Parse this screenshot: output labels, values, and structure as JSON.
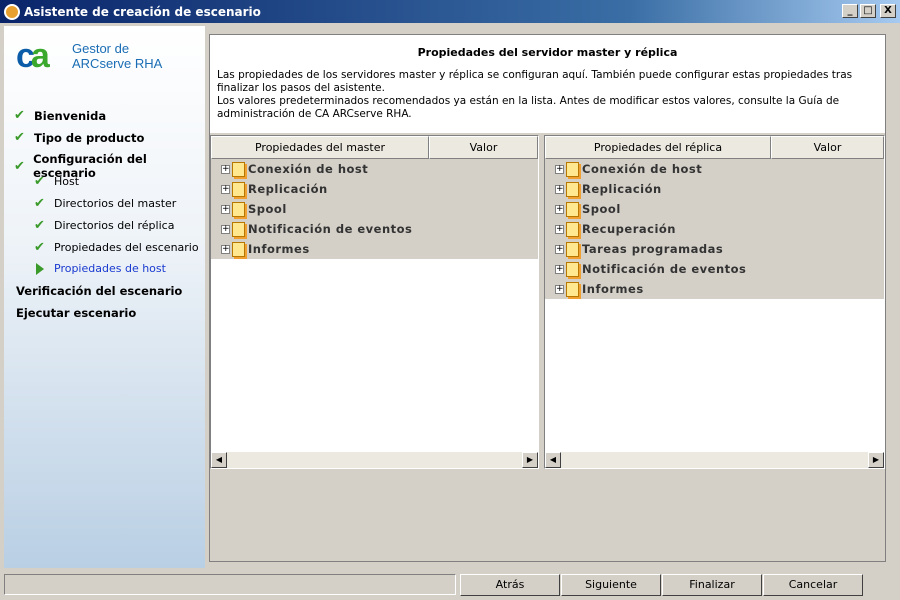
{
  "window": {
    "title": "Asistente de creación de escenario",
    "min": "_",
    "max": "□",
    "close": "X"
  },
  "logo": {
    "mark": "ca",
    "line1": "Gestor de",
    "line2": "ARCserve RHA"
  },
  "steps": [
    {
      "label": "Bienvenida",
      "state": "done"
    },
    {
      "label": "Tipo de producto",
      "state": "done"
    },
    {
      "label": "Configuración del escenario",
      "state": "done"
    },
    {
      "label": "Host",
      "state": "done"
    },
    {
      "label": "Directorios del master",
      "state": "done"
    },
    {
      "label": "Directorios del réplica",
      "state": "done"
    },
    {
      "label": "Propiedades del escenario",
      "state": "done"
    },
    {
      "label": "Propiedades de host",
      "state": "current"
    },
    {
      "label": "Verificación del escenario",
      "state": "pending"
    },
    {
      "label": "Ejecutar escenario",
      "state": "pending"
    }
  ],
  "header": {
    "title": "Propiedades del servidor master y réplica",
    "p1": "Las propiedades de los servidores master y réplica se configuran aquí. También puede configurar estas propiedades tras finalizar los pasos del asistente.",
    "p2": "Los valores predeterminados recomendados ya están en la lista. Antes de modificar estos valores, consulte la Guía de administración de CA ARCserve RHA."
  },
  "master": {
    "col1": "Propiedades del master",
    "col2": "Valor",
    "items": [
      "Conexión de host",
      "Replicación",
      "Spool",
      "Notificación de eventos",
      "Informes"
    ]
  },
  "replica": {
    "col1": "Propiedades del réplica",
    "col2": "Valor",
    "items": [
      "Conexión de host",
      "Replicación",
      "Spool",
      "Recuperación",
      "Tareas programadas",
      "Notificación de eventos",
      "Informes"
    ]
  },
  "buttons": {
    "back": "Atrás",
    "next": "Siguiente",
    "finish": "Finalizar",
    "cancel": "Cancelar"
  },
  "scroll": {
    "left": "◀",
    "right": "▶"
  },
  "check": "✔"
}
